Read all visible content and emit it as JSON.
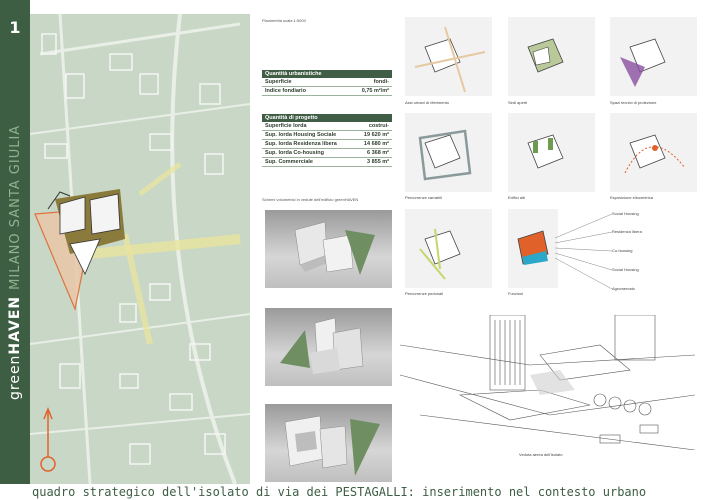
{
  "band": {
    "number": "1",
    "title_prefix": "green",
    "title_bold": "HAVEN",
    "location": "MILANO SANTA GIULIA"
  },
  "plan_scale": "Planimetria scala 1:5000",
  "urban": {
    "header": "Quantità urbanistiche",
    "rows": [
      {
        "label": "Superficie",
        "value": "fondi-"
      },
      {
        "label": "Indice fondiario",
        "value": "0,75 m²/m²"
      }
    ]
  },
  "project": {
    "header": "Quantità di progetto",
    "rows": [
      {
        "label": "Superficie          lorda",
        "value": "costrui-"
      },
      {
        "label": "Sup. lorda Housing Sociale",
        "value": "19 620 m²"
      },
      {
        "label": "Sup. lorda Residenza libera",
        "value": "14 680 m²"
      },
      {
        "label": "Sup. lorda Co-housing",
        "value": "6 368 m²"
      },
      {
        "label": "Sup. Commerciale",
        "value": "3 855 m²"
      }
    ]
  },
  "volumetric_caption": "Schemi volumetrici in vedute dell'edificio greenHAVEN",
  "diagrams": [
    {
      "caption": "Assi urbani di riferimento"
    },
    {
      "caption": "Sedi aperti"
    },
    {
      "caption": "Spazi tecnici di protezione"
    },
    {
      "caption": "Percorrenze carrabili"
    },
    {
      "caption": "Edifici alti"
    },
    {
      "caption": "Esposizione eliocentrica"
    },
    {
      "caption": "Percorrenze pedonali"
    },
    {
      "caption": "Funzioni"
    }
  ],
  "functions_legend": [
    "Social Housing",
    "Residenza libera",
    "Co-housing",
    "Social Housing",
    "Agromercato"
  ],
  "sketch_caption": "Veduta aerea dell'isolato",
  "bottom_title": "quadro strategico dell'isolato di via dei PESTAGALLI: inserimento nel contesto urbano",
  "colors": {
    "band": "#3e5e44",
    "map_bg": "#c9d8c6",
    "accent_orange": "#e0622a",
    "path_yellow": "#e8e4a0"
  }
}
